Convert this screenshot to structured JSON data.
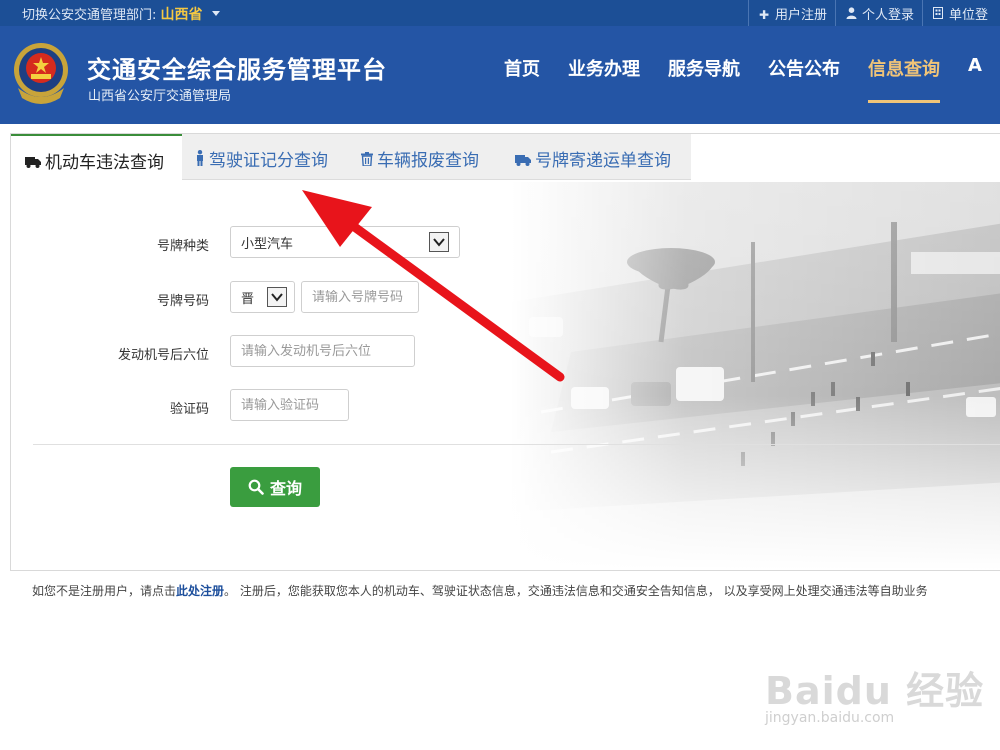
{
  "topbar": {
    "dept_label": "切换公安交通管理部门:",
    "province": "山西省",
    "links": [
      {
        "icon": "plus-icon",
        "label": "用户注册"
      },
      {
        "icon": "user-icon",
        "label": "个人登录"
      },
      {
        "icon": "building-icon",
        "label": "单位登"
      }
    ]
  },
  "header": {
    "title": "交通安全综合服务管理平台",
    "subtitle": "山西省公安厅交通管理局",
    "nav": [
      {
        "label": "首页",
        "active": false
      },
      {
        "label": "业务办理",
        "active": false
      },
      {
        "label": "服务导航",
        "active": false
      },
      {
        "label": "公告公布",
        "active": false
      },
      {
        "label": "信息查询",
        "active": true
      },
      {
        "label": "A",
        "active": false
      }
    ]
  },
  "tabs": [
    {
      "icon": "truck-icon",
      "label": "机动车违法查询",
      "active": true
    },
    {
      "icon": "person-icon",
      "label": "驾驶证记分查询",
      "active": false
    },
    {
      "icon": "trash-icon",
      "label": "车辆报废查询",
      "active": false
    },
    {
      "icon": "truck-icon",
      "label": "号牌寄递运单查询",
      "active": false
    }
  ],
  "form": {
    "plate_type": {
      "label": "号牌种类",
      "value": "小型汽车"
    },
    "plate_number": {
      "label": "号牌号码",
      "prefix": "晋",
      "placeholder": "请输入号牌号码"
    },
    "engine": {
      "label": "发动机号后六位",
      "placeholder": "请输入发动机号后六位"
    },
    "captcha": {
      "label": "验证码",
      "placeholder": "请输入验证码"
    },
    "submit_label": "查询"
  },
  "note": {
    "before": "如您不是注册用户，请点击",
    "link": "此处注册",
    "after": "。 注册后，您能获取您本人的机动车、驾驶证状态信息，交通违法信息和交通安全告知信息， 以及享受网上处理交通违法等自助业务"
  },
  "watermark": {
    "brand": "Baidu 经验",
    "url": "jingyan.baidu.com"
  },
  "colors": {
    "header_blue": "#2455a5",
    "topbar_blue": "#1c4f96",
    "accent_gold": "#f0c478",
    "button_green": "#3a9d3f",
    "arrow_red": "#e8141b"
  }
}
